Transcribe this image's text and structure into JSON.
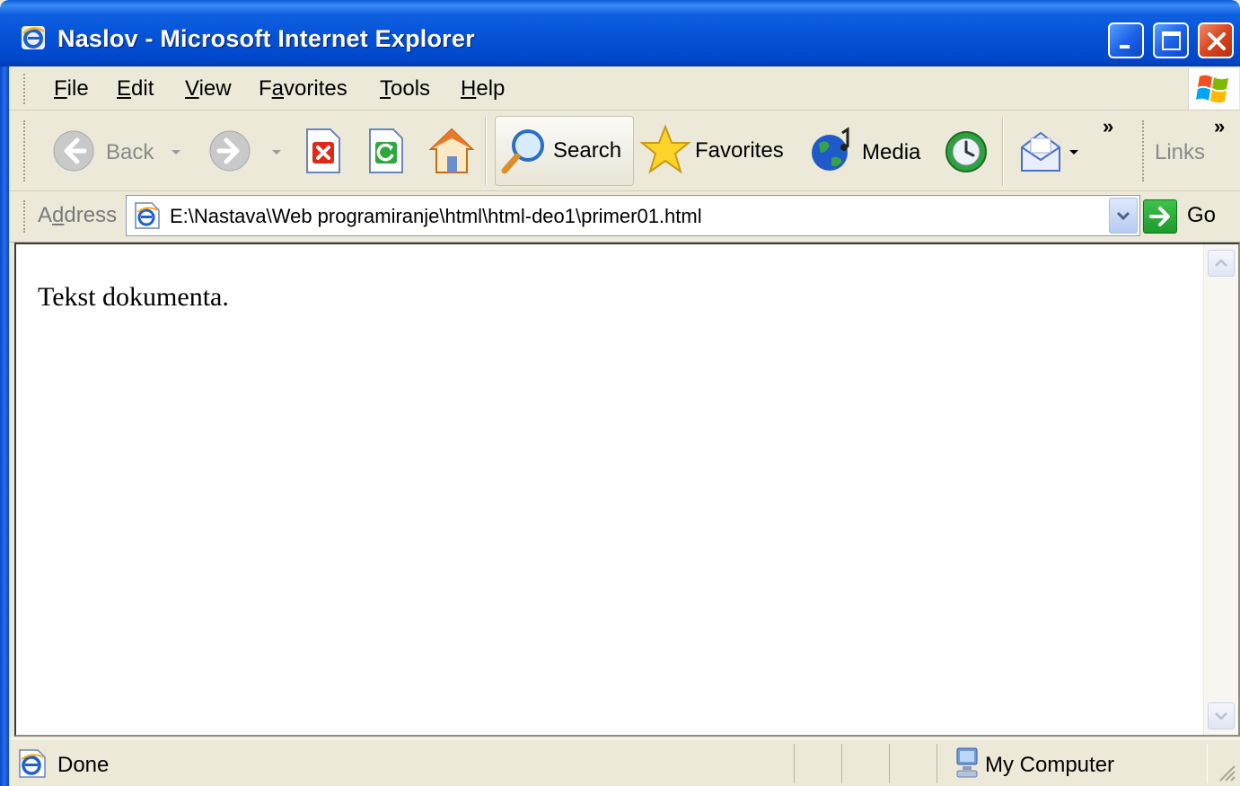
{
  "window": {
    "title": "Naslov - Microsoft Internet Explorer"
  },
  "menu": {
    "items": [
      {
        "label": "File",
        "accel": "F",
        "rest": "ile"
      },
      {
        "label": "Edit",
        "accel": "E",
        "rest": "dit"
      },
      {
        "label": "View",
        "accel": "V",
        "rest": "iew"
      },
      {
        "label": "Favorites",
        "pre": "F",
        "accel": "a",
        "rest": "vorites"
      },
      {
        "label": "Tools",
        "accel": "T",
        "rest": "ools"
      },
      {
        "label": "Help",
        "accel": "H",
        "rest": "elp"
      }
    ]
  },
  "toolbar": {
    "back_label": "Back",
    "search_label": "Search",
    "favorites_label": "Favorites",
    "media_label": "Media",
    "links_label": "Links",
    "chevron": "»"
  },
  "address": {
    "label_pre": "A",
    "label_accel": "d",
    "label_rest": "dress",
    "url": "E:\\Nastava\\Web programiranje\\html\\html-deo1\\primer01.html",
    "go_label": "Go"
  },
  "content": {
    "text": "Tekst dokumenta."
  },
  "status": {
    "text": "Done",
    "zone": "My Computer"
  },
  "colors": {
    "title_bar": "#0550d6",
    "chrome": "#ece9d8",
    "close_button": "#d8451e"
  }
}
